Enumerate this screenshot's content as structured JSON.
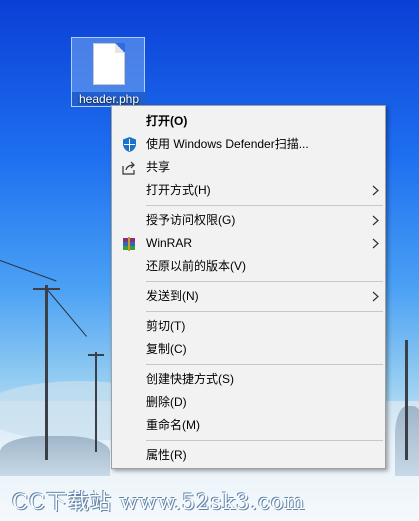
{
  "desktop": {
    "file_icon_name": "header.php"
  },
  "menu": {
    "items": [
      {
        "label": "打开(O)",
        "bold": true,
        "icon": ""
      },
      {
        "label": "使用 Windows Defender扫描...",
        "icon": "windows-defender-icon"
      },
      {
        "label": "共享",
        "icon": "share-icon"
      },
      {
        "label": "打开方式(H)",
        "submenu": true
      },
      {
        "label": "授予访问权限(G)",
        "submenu": true
      },
      {
        "label": "WinRAR",
        "icon": "winrar-icon",
        "submenu": true
      },
      {
        "label": "还原以前的版本(V)"
      },
      {
        "label": "发送到(N)",
        "submenu": true
      },
      {
        "label": "剪切(T)"
      },
      {
        "label": "复制(C)"
      },
      {
        "label": "创建快捷方式(S)"
      },
      {
        "label": "删除(D)"
      },
      {
        "label": "重命名(M)"
      },
      {
        "label": "属性(R)"
      }
    ]
  },
  "watermark": "CC下载站 www.52sk3.com",
  "colors": {
    "menu_bg": "#f2f2f2",
    "separator": "#c8c8c8",
    "defender_blue": "#1a73c8"
  }
}
